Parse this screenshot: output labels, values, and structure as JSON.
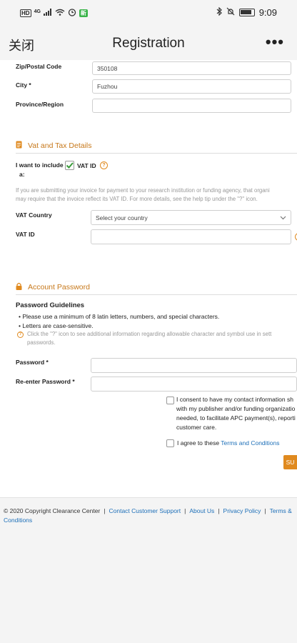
{
  "status_bar": {
    "hd": "HD",
    "network": "4G",
    "app_badge": "新",
    "time": "9:09"
  },
  "nav": {
    "close_label": "关闭",
    "title": "Registration",
    "more_label": "•••"
  },
  "address": {
    "zip_label": "Zip/Postal Code",
    "zip_value": "350108",
    "city_label": "City *",
    "city_value": "Fuzhou",
    "province_label": "Province/Region",
    "province_value": ""
  },
  "vat": {
    "heading": "Vat and Tax Details",
    "include_label_1": "I want to include",
    "include_label_2": "a:",
    "checkbox_label": "VAT ID",
    "checked": true,
    "help_line_1": "If you are submitting your invoice for payment to your research institution or funding agency, that organi",
    "help_line_2": "may require that the invoice reflect its VAT ID. For more details, see the help tip under the \"?\" icon.",
    "country_label": "VAT Country",
    "country_placeholder": "Select your country",
    "vat_id_label": "VAT ID",
    "vat_id_value": ""
  },
  "password": {
    "heading": "Account Password",
    "guidelines_title": "Password Guidelines",
    "rule_1": "Please use a minimum of 8 latin letters, numbers, and special characters.",
    "rule_2": "Letters are case-sensitive.",
    "hint_line_1": "Click the \"?\" icon to see additional information regarding allowable character and symbol use in sett",
    "hint_line_2": "passwords.",
    "password_label": "Password *",
    "reenter_label": "Re-enter Password *"
  },
  "consent": {
    "line_1": "I consent to have my contact information sh",
    "line_2": "with my publisher and/or funding organizatio",
    "line_3": "needed, to facilitate APC payment(s), reporti",
    "line_4": "customer care.",
    "terms_prefix": "I agree to these ",
    "terms_link": "Terms and Conditions",
    "submit_label": "SU"
  },
  "footer": {
    "copyright": "© 2020 Copyright Clearance Center",
    "link_support": "Contact Customer Support",
    "link_about": "About Us",
    "link_privacy": "Privacy Policy",
    "link_terms_1": "Terms &",
    "link_terms_2": "Conditions"
  },
  "colors": {
    "accent": "#c7781a",
    "link": "#1d6fb8",
    "check_green": "#3a9b3a"
  }
}
